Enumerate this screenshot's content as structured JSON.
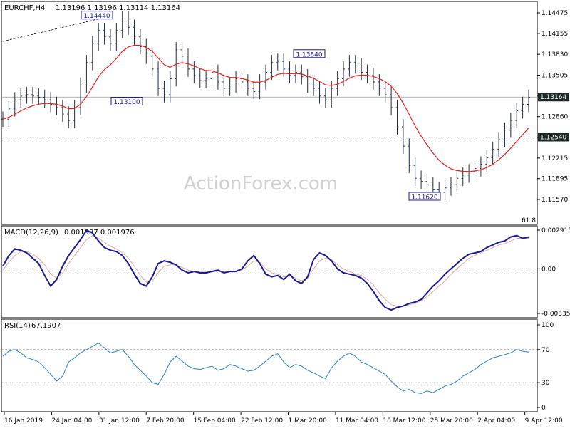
{
  "header": {
    "symbol": "EURCHF,H4",
    "ohlc": "1.13196 1.13196 1.13114 1.13164"
  },
  "watermark": "ActionForex.com",
  "colors": {
    "price": "#1f2a44",
    "ma": "#e0201d",
    "macd": "#1a1a8c",
    "signal": "#d9a7a7",
    "rsi": "#2b7fbf",
    "grid": "#000000"
  },
  "chart_data": [
    {
      "type": "bar",
      "pane": "price",
      "title": "EURCHF,H4",
      "ylim": [
        1.1545,
        1.1465
      ],
      "y_ticks": [
        "1.14475",
        "1.14155",
        "1.13830",
        "1.13505",
        "1.13180",
        "1.12860",
        "1.12535",
        "1.12215",
        "1.11895",
        "1.11570"
      ],
      "y_ticks_values": [
        1.14475,
        1.14155,
        1.1383,
        1.13505,
        1.1318,
        1.1286,
        1.12535,
        1.12215,
        1.11895,
        1.1157
      ],
      "x_labels": [
        "16 Jan 2019",
        "24 Jan 04:00",
        "31 Jan 12:00",
        "7 Feb 20:00",
        "15 Feb 04:00",
        "22 Feb 12:00",
        "1 Mar 20:00",
        "11 Mar 04:00",
        "18 Mar 12:00",
        "25 Mar 20:00",
        "2 Apr 04:00",
        "9 Apr 12:00"
      ],
      "last_price": "1.13164",
      "last_price_value": 1.13164,
      "support_level": "1.12540",
      "support_level_value": 1.1254,
      "fib_label": "61.8",
      "annotations": [
        {
          "text": "1.14440",
          "value": 1.1444
        },
        {
          "text": "1.13100",
          "value": 1.131
        },
        {
          "text": "1.13840",
          "value": 1.1384
        },
        {
          "text": "1.11620",
          "value": 1.1162
        }
      ],
      "closes": [
        1.1282,
        1.1298,
        1.1312,
        1.1318,
        1.132,
        1.1318,
        1.1316,
        1.1312,
        1.1305,
        1.13,
        1.129,
        1.128,
        1.13,
        1.1335,
        1.137,
        1.14,
        1.142,
        1.141,
        1.14,
        1.142,
        1.1438,
        1.1425,
        1.141,
        1.1395,
        1.138,
        1.136,
        1.133,
        1.132,
        1.1345,
        1.139,
        1.138,
        1.136,
        1.135,
        1.1342,
        1.1345,
        1.1355,
        1.134,
        1.133,
        1.1335,
        1.1345,
        1.134,
        1.133,
        1.1325,
        1.134,
        1.1355,
        1.137,
        1.1372,
        1.136,
        1.135,
        1.1355,
        1.1348,
        1.1335,
        1.133,
        1.1318,
        1.1312,
        1.133,
        1.1345,
        1.136,
        1.137,
        1.1365,
        1.1355,
        1.135,
        1.134,
        1.133,
        1.132,
        1.13,
        1.127,
        1.124,
        1.121,
        1.119,
        1.1185,
        1.118,
        1.1172,
        1.1168,
        1.1175,
        1.118,
        1.119,
        1.1195,
        1.12,
        1.1205,
        1.1212,
        1.1222,
        1.1235,
        1.125,
        1.1265,
        1.128,
        1.1295,
        1.1305,
        1.1316
      ]
    },
    {
      "type": "line",
      "pane": "macd",
      "title": "MACD(12,26,9)",
      "values_text": "0.001987 0.001976",
      "ylim": [
        -0.003357,
        0.002915
      ],
      "y_ticks": [
        "0.002915",
        "0.00",
        "-0.003357"
      ],
      "y_ticks_values": [
        0.002915,
        0.0,
        -0.003357
      ],
      "series": [
        {
          "values": [
            0.0002,
            0.001,
            0.0015,
            0.0014,
            0.0012,
            0.0008,
            0.0004,
            -0.0005,
            -0.0013,
            -0.0008,
            0.0002,
            0.001,
            0.0016,
            0.0022,
            0.0029,
            0.0027,
            0.0021,
            0.0016,
            0.0014,
            0.0013,
            0.001,
            0.0004,
            -0.0004,
            -0.0011,
            -0.0013,
            -0.0006,
            0.0004,
            0.0006,
            0.0005,
            0.0003,
            -0.0001,
            -0.0003,
            -0.0002,
            -0.0003,
            -0.0003,
            -0.0002,
            -0.0001,
            -0.0003,
            -0.0002,
            -0.0002,
            0.0,
            0.0006,
            0.001,
            0.0004,
            -0.0004,
            -0.0006,
            -0.0005,
            -0.0008,
            -0.0004,
            -0.0009,
            -0.0011,
            -0.0006,
            0.0007,
            0.0012,
            0.001,
            0.0006,
            0.0,
            -0.0003,
            -0.0004,
            -0.0005,
            -0.0007,
            -0.0011,
            -0.0017,
            -0.0024,
            -0.0029,
            -0.0031,
            -0.0029,
            -0.0028,
            -0.0026,
            -0.0025,
            -0.0023,
            -0.0018,
            -0.0013,
            -0.0009,
            -0.0004,
            0.0,
            0.0004,
            0.0008,
            0.0011,
            0.0012,
            0.0013,
            0.0016,
            0.0018,
            0.002,
            0.0021,
            0.0024,
            0.0025,
            0.0023,
            0.0024
          ]
        },
        {
          "values": [
            -0.0001,
            0.0005,
            0.001,
            0.0013,
            0.0013,
            0.0011,
            0.0008,
            0.0003,
            -0.0004,
            -0.0007,
            -0.0003,
            0.0004,
            0.001,
            0.0016,
            0.0022,
            0.0025,
            0.0023,
            0.002,
            0.0017,
            0.0015,
            0.0012,
            0.0008,
            0.0002,
            -0.0005,
            -0.001,
            -0.0009,
            -0.0003,
            0.0002,
            0.0003,
            0.0003,
            0.0001,
            -0.0001,
            -0.0002,
            -0.0002,
            -0.0002,
            -0.0002,
            -0.0002,
            -0.0002,
            -0.0002,
            -0.0002,
            -0.0001,
            0.0002,
            0.0006,
            0.0005,
            0.0,
            -0.0003,
            -0.0004,
            -0.0006,
            -0.0005,
            -0.0007,
            -0.0009,
            -0.0007,
            0.0,
            0.0006,
            0.0008,
            0.0007,
            0.0003,
            0.0,
            -0.0002,
            -0.0004,
            -0.0005,
            -0.0008,
            -0.0012,
            -0.0018,
            -0.0023,
            -0.0027,
            -0.0028,
            -0.0028,
            -0.0027,
            -0.0026,
            -0.0024,
            -0.0021,
            -0.0017,
            -0.0013,
            -0.0009,
            -0.0004,
            0.0,
            0.0004,
            0.0008,
            0.001,
            0.0012,
            0.0014,
            0.0016,
            0.0018,
            0.0019,
            0.0021,
            0.0023,
            0.0023,
            0.0023
          ]
        }
      ]
    },
    {
      "type": "line",
      "pane": "rsi",
      "title": "RSI(14)",
      "values_text": "67.1907",
      "ylim": [
        0,
        100
      ],
      "y_ticks": [
        "100",
        "70",
        "30",
        "0"
      ],
      "y_ticks_values": [
        100,
        70,
        30,
        0
      ],
      "series": [
        {
          "values": [
            62,
            68,
            70,
            66,
            60,
            58,
            55,
            48,
            40,
            32,
            38,
            55,
            60,
            66,
            70,
            74,
            78,
            72,
            66,
            68,
            70,
            62,
            52,
            45,
            38,
            30,
            28,
            40,
            55,
            62,
            56,
            50,
            47,
            46,
            48,
            50,
            45,
            47,
            52,
            50,
            47,
            44,
            45,
            50,
            56,
            62,
            65,
            55,
            48,
            52,
            50,
            45,
            42,
            38,
            35,
            48,
            56,
            62,
            66,
            62,
            55,
            52,
            48,
            44,
            40,
            32,
            25,
            20,
            22,
            18,
            17,
            20,
            18,
            22,
            26,
            28,
            32,
            38,
            42,
            46,
            52,
            56,
            60,
            62,
            64,
            66,
            70,
            68,
            67
          ]
        }
      ]
    }
  ]
}
